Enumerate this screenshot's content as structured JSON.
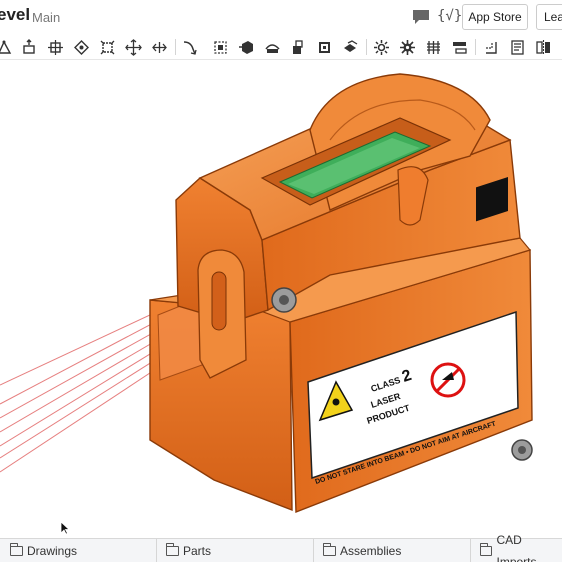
{
  "header": {
    "title": "evel",
    "branch": "Main",
    "app_store_label": "App Store",
    "learn_label": "Lea"
  },
  "toolbar": {
    "icons": [
      "sketch-icon",
      "extrude-icon",
      "revolve-icon",
      "sweep-icon",
      "loft-icon",
      "thicken-icon",
      "enclose-icon",
      "fillet-icon",
      "chamfer-icon",
      "draft-icon",
      "shell-icon",
      "hole-icon",
      "rib-icon",
      "boolean-icon",
      "split-icon",
      "transform-icon",
      "pattern-icon",
      "mirror-icon",
      "helix-icon",
      "mate-connector-icon",
      "plane-icon",
      "sheet-metal-icon",
      "frame-icon"
    ]
  },
  "label": {
    "class_line1": "CLASS",
    "class_number": "2",
    "class_line2": "LASER",
    "class_line3": "PRODUCT",
    "warning_text": "DO NOT STARE INTO BEAM • DO NOT AIM AT AIRCRAFT"
  },
  "tabs": [
    {
      "label": "Drawings"
    },
    {
      "label": "Parts"
    },
    {
      "label": "Assemblies"
    },
    {
      "label": "CAD Imports"
    }
  ],
  "colors": {
    "body_orange": "#e8701f",
    "dark_orange": "#b84d0c",
    "light_orange": "#f59a4e",
    "laser_red": "#e05a5a",
    "vial_green": "#3fae5a"
  }
}
